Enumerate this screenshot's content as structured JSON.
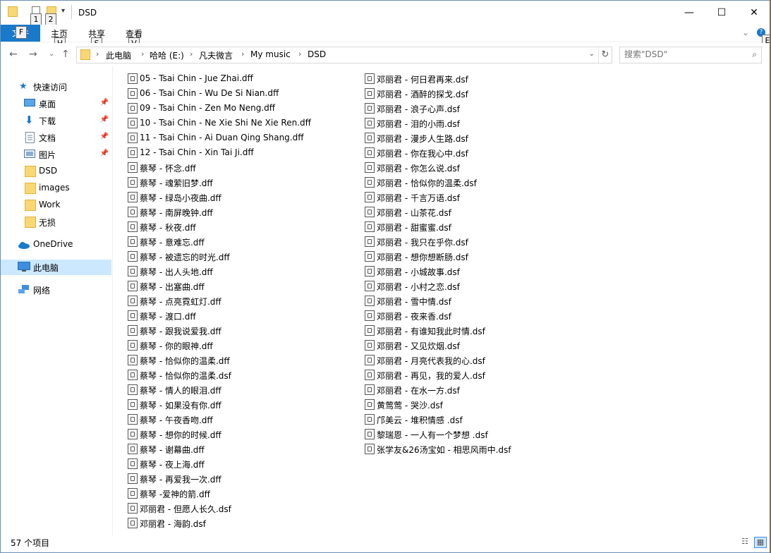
{
  "window": {
    "title": "DSD"
  },
  "titlebar": {
    "minimize_label": "—",
    "maximize_label": "☐",
    "close_label": "✕",
    "keytips": [
      "1",
      "2"
    ]
  },
  "ribbon": {
    "file_label": "文件",
    "file_keytip": "F",
    "tabs": [
      {
        "label": "主页",
        "keytip": "H"
      },
      {
        "label": "共享",
        "keytip": "S"
      },
      {
        "label": "查看",
        "keytip": "V"
      }
    ],
    "help_keytip": "E"
  },
  "address": {
    "crumbs": [
      "此电脑",
      "哈哈 (E:)",
      "凡夫微言",
      "My music",
      "DSD"
    ]
  },
  "search": {
    "placeholder": "搜索\"DSD\""
  },
  "nav": {
    "quick_access": "快速访问",
    "items": [
      "桌面",
      "下载",
      "文档",
      "图片",
      "DSD",
      "images",
      "Work",
      "无损"
    ],
    "onedrive": "OneDrive",
    "this_pc": "此电脑",
    "network": "网络"
  },
  "files": {
    "col1": [
      "05 - Tsai Chin - Jue Zhai.dff",
      "06 - Tsai Chin - Wu De Si Nian.dff",
      "09 - Tsai Chin - Zen Mo Neng.dff",
      "10 - Tsai Chin - Ne Xie Shi Ne Xie Ren.dff",
      "11 - Tsai Chin - Ai Duan Qing Shang.dff",
      "12 - Tsai Chin - Xin Tai Ji.dff",
      "蔡琴 -  怀念.dff",
      "蔡琴 -  魂萦旧梦.dff",
      "蔡琴 -  绿岛小夜曲.dff",
      "蔡琴 -  南屏晚钟.dff",
      "蔡琴 -  秋夜.dff",
      "蔡琴 -  意难忘.dff",
      "蔡琴 - 被遗忘的时光.dff",
      "蔡琴 - 出人头地.dff",
      "蔡琴 - 出塞曲.dff",
      "蔡琴 - 点亮霓虹灯.dff",
      "蔡琴 - 渡口.dff",
      "蔡琴 - 跟我说爱我.dff",
      "蔡琴 - 你的眼神.dff",
      "蔡琴 - 恰似你的温柔.dff",
      "蔡琴 - 恰似你的温柔.dsf",
      "蔡琴 - 情人的眼泪.dff",
      "蔡琴 - 如果没有你.dff",
      "蔡琴 - 午夜香吻.dff",
      "蔡琴 - 想你的时候.dff",
      "蔡琴 - 谢幕曲.dff",
      "蔡琴 - 夜上海.dff",
      "蔡琴 - 再爱我一次.dff",
      "蔡琴 -爱神的箭.dff",
      "邓丽君 - 但愿人长久.dsf",
      "邓丽君 - 海韵.dsf"
    ],
    "col2": [
      "邓丽君 - 何日君再来.dsf",
      "邓丽君 - 酒醉的探戈.dsf",
      "邓丽君 - 浪子心声.dsf",
      "邓丽君 - 泪的小雨.dsf",
      "邓丽君 - 漫步人生路.dsf",
      "邓丽君 - 你在我心中.dsf",
      "邓丽君 - 你怎么说.dsf",
      "邓丽君 - 恰似你的温柔.dsf",
      "邓丽君 - 千言万语.dsf",
      "邓丽君 - 山茶花.dsf",
      "邓丽君 - 甜蜜蜜.dsf",
      "邓丽君 - 我只在乎你.dsf",
      "邓丽君 - 想你想断肠.dsf",
      "邓丽君 - 小城故事.dsf",
      "邓丽君 - 小村之恋.dsf",
      "邓丽君 - 雪中情.dsf",
      "邓丽君 - 夜来香.dsf",
      "邓丽君 - 有谁知我此时情.dsf",
      "邓丽君 - 又见炊烟.dsf",
      "邓丽君 - 月亮代表我的心.dsf",
      "邓丽君 - 再见，我的爱人.dsf",
      "邓丽君 - 在水一方.dsf",
      "黄莺莺 - 哭沙.dsf",
      "邝美云 - 堆积情感 .dsf",
      "黎瑞恩 - 一人有一个梦想 .dsf",
      "张学友&26汤宝如 - 相思风雨中.dsf"
    ]
  },
  "status": {
    "count": "57 个项目"
  }
}
